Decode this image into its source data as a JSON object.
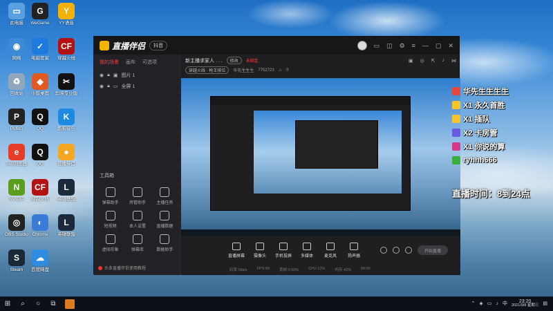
{
  "desktop": {
    "icons": [
      {
        "label": "此电脑",
        "color": "#5aa0e0",
        "glyph": "▭"
      },
      {
        "label": "WeGame",
        "color": "#222",
        "glyph": "G"
      },
      {
        "label": "YY语音",
        "color": "#f2b20a",
        "glyph": "Y"
      },
      {
        "label": "网络",
        "color": "#3b8ad6",
        "glyph": "◉"
      },
      {
        "label": "电脑管家",
        "color": "#1f7ae0",
        "glyph": "✓"
      },
      {
        "label": "穿越火线",
        "color": "#b31212",
        "glyph": "CF"
      },
      {
        "label": "回收站",
        "color": "#8fa6bd",
        "glyph": "♻"
      },
      {
        "label": "小智桌面",
        "color": "#e05a22",
        "glyph": "◆"
      },
      {
        "label": "剪映专业版",
        "color": "#111",
        "glyph": "✂"
      },
      {
        "label": "PUBG",
        "color": "#222",
        "glyph": "P"
      },
      {
        "label": "QQ",
        "color": "#111",
        "glyph": "Q"
      },
      {
        "label": "酷狗音乐",
        "color": "#1d8ae0",
        "glyph": "K"
      },
      {
        "label": "360浏览器",
        "color": "#e53d2a",
        "glyph": "e"
      },
      {
        "label": "QQ",
        "color": "#111",
        "glyph": "Q"
      },
      {
        "label": "直播伴侣",
        "color": "#f5a623",
        "glyph": "●"
      },
      {
        "label": "NVIDIA",
        "color": "#5b9e1e",
        "glyph": "N"
      },
      {
        "label": "穿越火线",
        "color": "#b31212",
        "glyph": "CF"
      },
      {
        "label": "英雄联盟",
        "color": "#1a2a3a",
        "glyph": "L"
      },
      {
        "label": "OBS Studio",
        "color": "#222",
        "glyph": "◎"
      },
      {
        "label": "Chrome",
        "color": "#3a7bd5",
        "glyph": "◐"
      },
      {
        "label": "英雄联盟",
        "color": "#1a2a3a",
        "glyph": "L"
      },
      {
        "label": "Steam",
        "color": "#1b2838",
        "glyph": "S"
      },
      {
        "label": "百度网盘",
        "color": "#2e8be0",
        "glyph": "☁"
      }
    ]
  },
  "app": {
    "title": "直播伴侣",
    "version_badge": "抖音",
    "side_tabs": [
      "我的场景",
      "画布",
      "可选项"
    ],
    "scenes": [
      "图片 1",
      "全屏 1"
    ],
    "tools_title": "工具箱",
    "tools": [
      "弹幕助手",
      "房管助手",
      "主播任务",
      "短视频",
      "本人设置",
      "直播数据",
      "虚拟形象",
      "弹幕库",
      "数据助手"
    ],
    "side_bottom": "头条直播伴侣使用教程",
    "stream_title": "新主播求家人 . . .",
    "edit_badge": "修改",
    "red_label": "未绑定",
    "category": "穿越火线 · 枪王排位",
    "nickname": "华先生生生",
    "room_id": "7752723",
    "viewers": "0",
    "bottom_tools": [
      "直播屏幕",
      "摄像头",
      "手机投屏",
      "多媒体",
      "麦克风",
      "扬声器"
    ],
    "start_button": "开始直播",
    "stats": [
      "码率 0kb/s",
      "FPS 60",
      "丢帧 0.00%",
      "CPU 12%",
      "内存 43%",
      "00:00"
    ]
  },
  "overlay": {
    "lines": [
      {
        "text": "华先生生生生",
        "color": "#e5483b"
      },
      {
        "text": "X1 永久首胜",
        "color": "#f5c52b"
      },
      {
        "text": "X1 插队",
        "color": "#f5c52b"
      },
      {
        "text": "X2 卡房管",
        "color": "#6a5adf"
      },
      {
        "text": "X1 你说的算",
        "color": "#d63a8a"
      },
      {
        "text": "ryhhh666",
        "color": "#3aae3a"
      }
    ],
    "live_time": "直播时间：8到24点"
  },
  "taskbar": {
    "time": "23:20",
    "date": "2021/9/8 星期三"
  }
}
